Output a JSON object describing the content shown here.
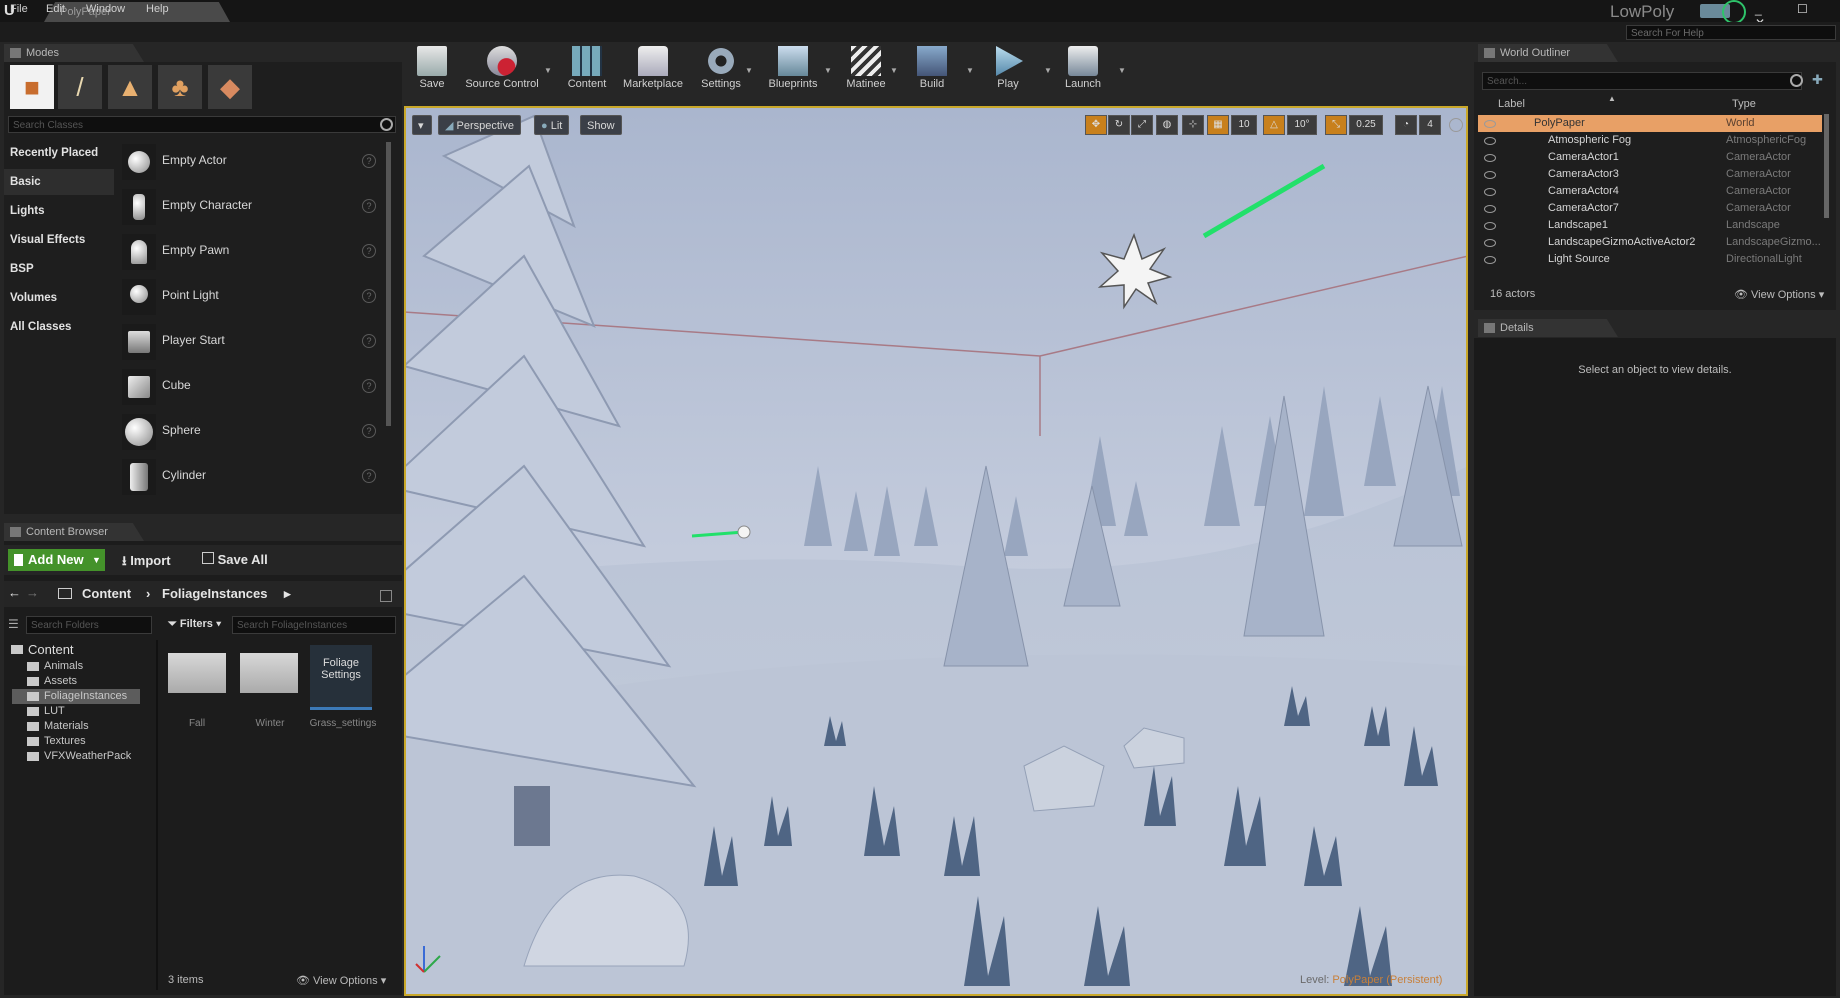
{
  "window": {
    "doc_tab": "PolyPaper",
    "project": "LowPoly",
    "help_search_placeholder": "Search For Help",
    "logo": "U",
    "controls": "_ ☐ ✕"
  },
  "menu": [
    "File",
    "Edit",
    "Window",
    "Help"
  ],
  "modes": {
    "tab": "Modes",
    "search_placeholder": "Search Classes",
    "categories": [
      "Recently Placed",
      "Basic",
      "Lights",
      "Visual Effects",
      "BSP",
      "Volumes",
      "All Classes"
    ],
    "items": [
      "Empty Actor",
      "Empty Character",
      "Empty Pawn",
      "Point Light",
      "Player Start",
      "Cube",
      "Sphere",
      "Cylinder"
    ],
    "help_glyph": "?"
  },
  "toolbar": [
    "Save",
    "Source Control",
    "Content",
    "Marketplace",
    "Settings",
    "Blueprints",
    "Matinee",
    "Build",
    "Play",
    "Launch"
  ],
  "content_browser": {
    "tab": "Content Browser",
    "add_new": "Add New",
    "import": "Import",
    "save_all": "Save All",
    "path": [
      "Content",
      "FoliageInstances"
    ],
    "folder_search_placeholder": "Search Folders",
    "filters": "Filters",
    "asset_search_placeholder": "Search FoliageInstances",
    "tree_root": "Content",
    "tree": [
      "Animals",
      "Assets",
      "FoliageInstances",
      "LUT",
      "Materials",
      "Textures",
      "VFXWeatherPack"
    ],
    "assets": [
      "Fall",
      "Winter",
      "Grass_settings"
    ],
    "asset_thumb_text": "Foliage Settings",
    "item_count": "3 items",
    "view_options": "View Options"
  },
  "viewport": {
    "perspective": "Perspective",
    "lit": "Lit",
    "show": "Show",
    "grid_snap": "10",
    "rotation_snap": "10°",
    "scale_snap": "0.25",
    "camera_speed": "4",
    "level_label": "Level:",
    "level_name": "PolyPaper (Persistent)"
  },
  "outliner": {
    "tab": "World Outliner",
    "search_placeholder": "Search...",
    "col_label": "Label",
    "col_type": "Type",
    "rows": [
      {
        "label": "PolyPaper",
        "type": "World"
      },
      {
        "label": "Atmospheric Fog",
        "type": "AtmosphericFog"
      },
      {
        "label": "CameraActor1",
        "type": "CameraActor"
      },
      {
        "label": "CameraActor3",
        "type": "CameraActor"
      },
      {
        "label": "CameraActor4",
        "type": "CameraActor"
      },
      {
        "label": "CameraActor7",
        "type": "CameraActor"
      },
      {
        "label": "Landscape1",
        "type": "Landscape"
      },
      {
        "label": "LandscapeGizmoActiveActor2",
        "type": "LandscapeGizmo..."
      },
      {
        "label": "Light Source",
        "type": "DirectionalLight"
      }
    ],
    "count": "16 actors",
    "view_options": "View Options"
  },
  "details": {
    "tab": "Details",
    "empty_message": "Select an object to view details."
  },
  "colors": {
    "accent_selected": "#e8a066",
    "add_new_green": "#44922a",
    "viewport_border": "#c9a82a"
  }
}
